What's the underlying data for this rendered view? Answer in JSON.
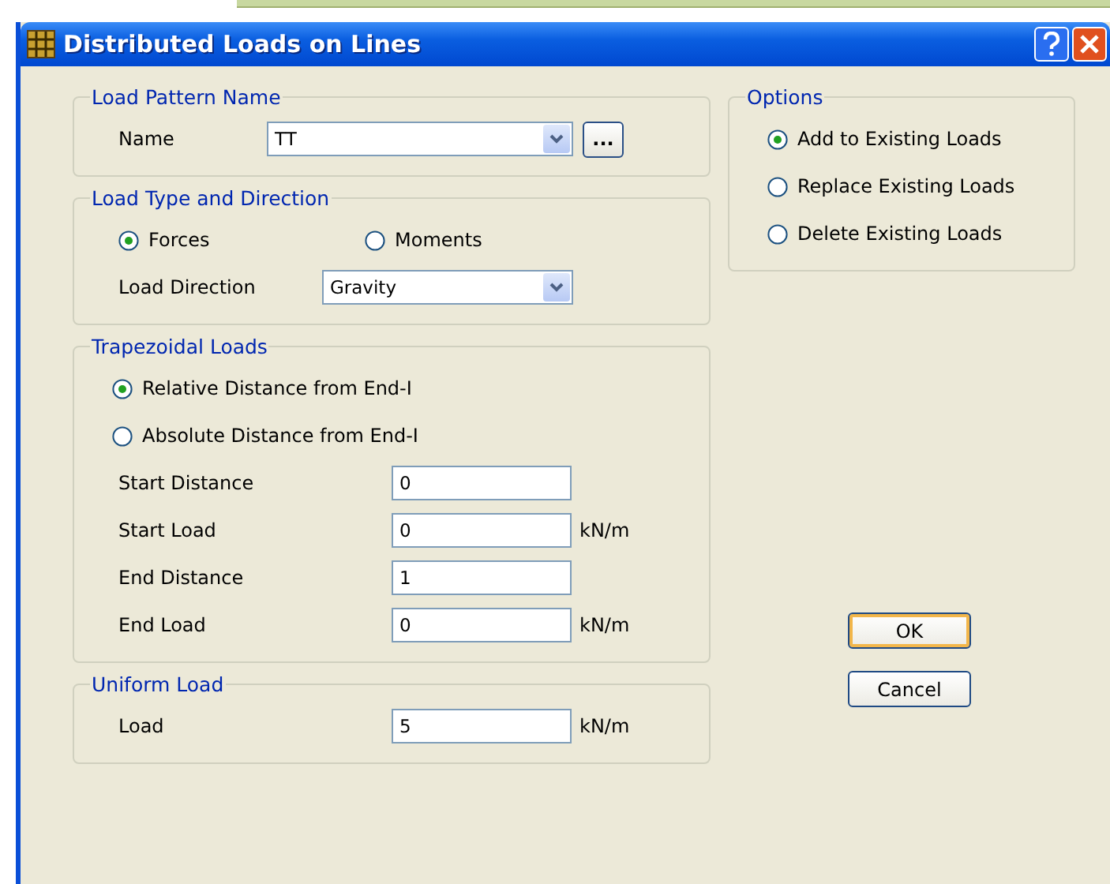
{
  "window": {
    "title": "Distributed Loads on Lines"
  },
  "load_pattern": {
    "title": "Load Pattern Name",
    "name_label": "Name",
    "name_value": "TT",
    "browse_button": "..."
  },
  "load_type": {
    "title": "Load Type and Direction",
    "options": [
      {
        "label": "Forces",
        "selected": true
      },
      {
        "label": "Moments",
        "selected": false
      }
    ],
    "direction_label": "Load Direction",
    "direction_value": "Gravity"
  },
  "trapezoidal": {
    "title": "Trapezoidal Loads",
    "options": [
      {
        "label": "Relative Distance from End-I",
        "selected": true
      },
      {
        "label": "Absolute Distance from End-I",
        "selected": false
      }
    ],
    "fields": [
      {
        "label": "Start Distance",
        "value": "0"
      },
      {
        "label": "Start Load",
        "value": "0",
        "unit": "kN/m"
      },
      {
        "label": "End Distance",
        "value": "1"
      },
      {
        "label": "End Load",
        "value": "0",
        "unit": "kN/m"
      }
    ]
  },
  "uniform": {
    "title": "Uniform Load",
    "fields": [
      {
        "label": "Load",
        "value": "5",
        "unit": "kN/m"
      }
    ]
  },
  "options": {
    "title": "Options",
    "items": [
      {
        "label": "Add to Existing Loads",
        "selected": true
      },
      {
        "label": "Replace Existing Loads",
        "selected": false
      },
      {
        "label": "Delete Existing Loads",
        "selected": false
      }
    ]
  },
  "buttons": [
    {
      "label": "OK",
      "default": true
    },
    {
      "label": "Cancel",
      "default": false
    }
  ]
}
